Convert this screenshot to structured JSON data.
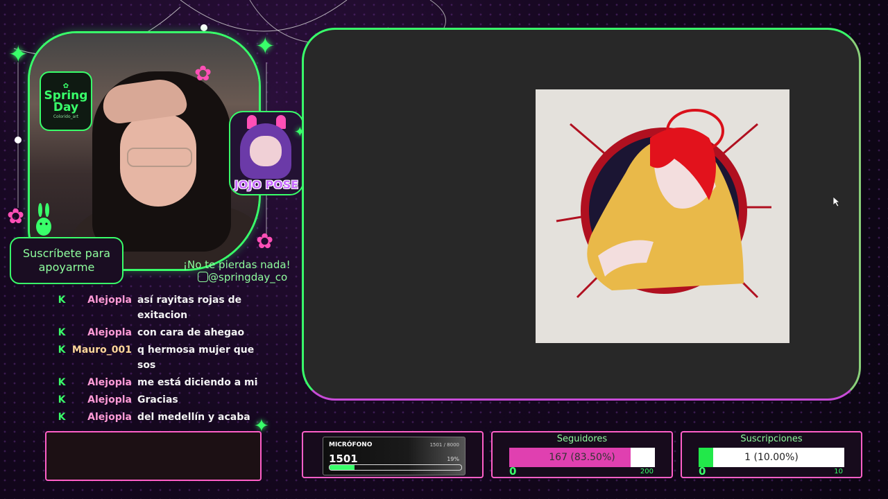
{
  "branding": {
    "logo_line1": "Spring",
    "logo_line2": "Day",
    "logo_line3": "Colorido_art",
    "avatar_tag": "JOJO POSE",
    "subscribe_line1": "Suscríbete para",
    "subscribe_line2": "apoyarme",
    "social_line": "¡No te pierdas nada!",
    "social_handle": "@springday_co"
  },
  "chat": [
    {
      "user": "Alejopla",
      "user_color": "#ff9bd6",
      "message": "así rayitas rojas de exitacion"
    },
    {
      "user": "Alejopla",
      "user_color": "#ff9bd6",
      "message": "con cara de ahegao"
    },
    {
      "user": "Mauro_001",
      "user_color": "#ffd79a",
      "message": "q hermosa mujer que sos"
    },
    {
      "user": "Alejopla",
      "user_color": "#ff9bd6",
      "message": "me está diciendo a mi"
    },
    {
      "user": "Alejopla",
      "user_color": "#ff9bd6",
      "message": "Gracias"
    },
    {
      "user": "Alejopla",
      "user_color": "#ff9bd6",
      "message": "del medellín y acaba"
    }
  ],
  "chat_badge_icon": "K",
  "microphone": {
    "title": "MICRÓFONO",
    "max_label": "1501 / 8000",
    "value": "1501",
    "percent_label": "19%",
    "fraction": 0.19
  },
  "followers_goal": {
    "title": "Seguidores",
    "progress_label": "167 (83.50%)",
    "fraction": 0.835,
    "min": "0",
    "max": "200",
    "fill_color": "#e040b0"
  },
  "subs_goal": {
    "title": "Suscripciones",
    "progress_label": "1 (10.00%)",
    "fraction": 0.1,
    "min": "0",
    "max": "10",
    "fill_color": "#22e84a"
  },
  "colors": {
    "accent_green": "#39ff6a",
    "accent_pink": "#ff5fc8",
    "background": "#15071f"
  }
}
